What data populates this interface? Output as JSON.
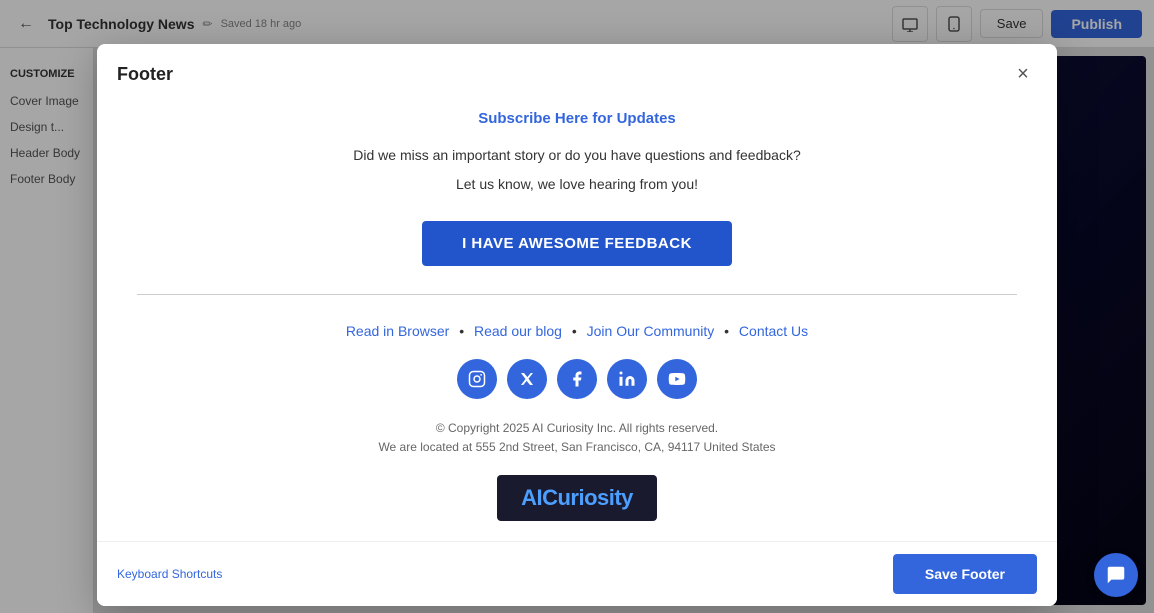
{
  "topbar": {
    "back_label": "←",
    "page_title": "Top Technology News",
    "edit_icon": "✏",
    "saved_text": "Saved 18 hr ago",
    "preview_icon": "⬜",
    "device_icon": "📱",
    "save_label": "Save",
    "publish_label": "Publish"
  },
  "sidebar": {
    "customize_label": "CUSTOMIZE",
    "cover_image_label": "Cover Image",
    "design_label": "Design t...",
    "header_body_label": "Header Body",
    "footer_body_label": "Footer Body"
  },
  "modal": {
    "title": "Footer",
    "close_icon": "×",
    "subscribe_title": "Subscribe Here for Updates",
    "description1": "Did we miss an important story or do you have questions and feedback?",
    "description2": "Let us know, we love hearing from you!",
    "feedback_button": "I HAVE AWESOME FEEDBACK",
    "links": {
      "read_browser": "Read in Browser",
      "read_blog": "Read our blog",
      "join_community": "Join Our Community",
      "contact_us": "Contact Us",
      "separator": "•"
    },
    "social_icons": [
      {
        "name": "instagram",
        "symbol": "📷"
      },
      {
        "name": "twitter",
        "symbol": "𝕏"
      },
      {
        "name": "facebook",
        "symbol": "f"
      },
      {
        "name": "linkedin",
        "symbol": "in"
      },
      {
        "name": "youtube",
        "symbol": "▶"
      }
    ],
    "copyright_line1": "© Copyright 2025 AI Curiosity Inc. All rights reserved.",
    "copyright_line2": "We are located at 555 2nd Street, San Francisco, CA, 94117 United States",
    "brand_name_prefix": "AI",
    "brand_name_suffix": "Curiosity",
    "footer_actions": {
      "keyboard_shortcuts": "Keyboard Shortcuts",
      "save_footer": "Save Footer"
    }
  }
}
